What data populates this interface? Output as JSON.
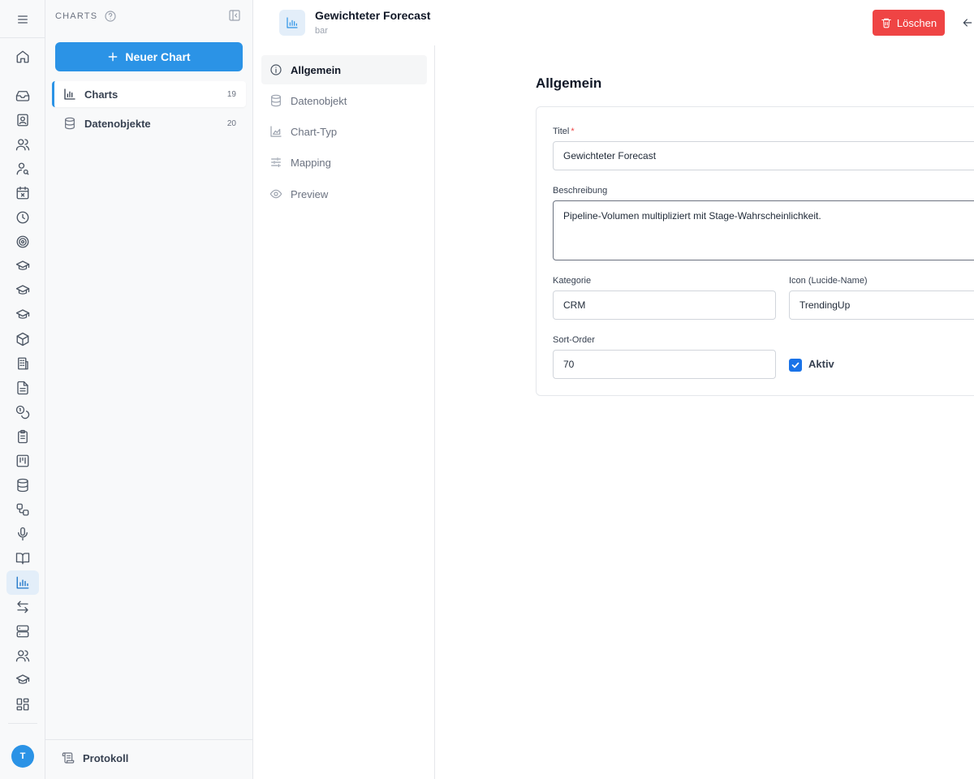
{
  "rail": {
    "items": [
      {
        "icon": "menu-icon"
      },
      {
        "icon": "home-icon"
      },
      {
        "icon": "inbox-icon"
      },
      {
        "icon": "contact-card-icon"
      },
      {
        "icon": "users-icon"
      },
      {
        "icon": "user-search-icon"
      },
      {
        "icon": "calendar-x-icon"
      },
      {
        "icon": "clock-icon"
      },
      {
        "icon": "target-icon"
      },
      {
        "icon": "graduation-cap-icon"
      },
      {
        "icon": "graduation-cap-icon"
      },
      {
        "icon": "graduation-cap-icon"
      },
      {
        "icon": "package-icon"
      },
      {
        "icon": "building-icon"
      },
      {
        "icon": "file-text-icon"
      },
      {
        "icon": "coins-icon"
      },
      {
        "icon": "clipboard-list-icon"
      },
      {
        "icon": "kanban-icon"
      },
      {
        "icon": "database-icon"
      },
      {
        "icon": "workflow-icon"
      },
      {
        "icon": "mic-icon"
      },
      {
        "icon": "book-open-icon"
      },
      {
        "icon": "bar-chart-icon",
        "active": true
      },
      {
        "icon": "arrow-left-right-icon"
      },
      {
        "icon": "server-icon"
      },
      {
        "icon": "users-icon"
      },
      {
        "icon": "graduation-cap-icon"
      },
      {
        "icon": "layout-grid-icon"
      }
    ],
    "avatar": "T"
  },
  "panel": {
    "title": "Charts",
    "new_button": "Neuer Chart",
    "items": [
      {
        "label": "Charts",
        "count": "19",
        "icon": "bar-chart-icon",
        "active": true
      },
      {
        "label": "Datenobjekte",
        "count": "20",
        "icon": "database-icon",
        "active": false
      }
    ],
    "footer": "Protokoll"
  },
  "topbar": {
    "title": "Gewichteter Forecast",
    "subtitle": "bar",
    "delete_label": "Löschen"
  },
  "sections": [
    {
      "label": "Allgemein",
      "icon": "info-icon",
      "active": true
    },
    {
      "label": "Datenobjekt",
      "icon": "database-icon"
    },
    {
      "label": "Chart-Typ",
      "icon": "area-chart-icon"
    },
    {
      "label": "Mapping",
      "icon": "sliders-icon"
    },
    {
      "label": "Preview",
      "icon": "eye-icon"
    }
  ],
  "form": {
    "heading": "Allgemein",
    "titel_label": "Titel",
    "titel_required": "*",
    "titel_value": "Gewichteter Forecast",
    "beschreibung_label": "Beschreibung",
    "beschreibung_value": "Pipeline-Volumen multipliziert mit Stage-Wahrscheinlichkeit.",
    "kategorie_label": "Kategorie",
    "kategorie_value": "CRM",
    "icon_label": "Icon (Lucide-Name)",
    "icon_value": "TrendingUp",
    "sort_label": "Sort-Order",
    "sort_value": "70",
    "aktiv_label": "Aktiv",
    "aktiv_checked": true
  },
  "colors": {
    "accent": "#2b93e6",
    "danger": "#ef4444",
    "checkbox": "#1a73e8"
  }
}
